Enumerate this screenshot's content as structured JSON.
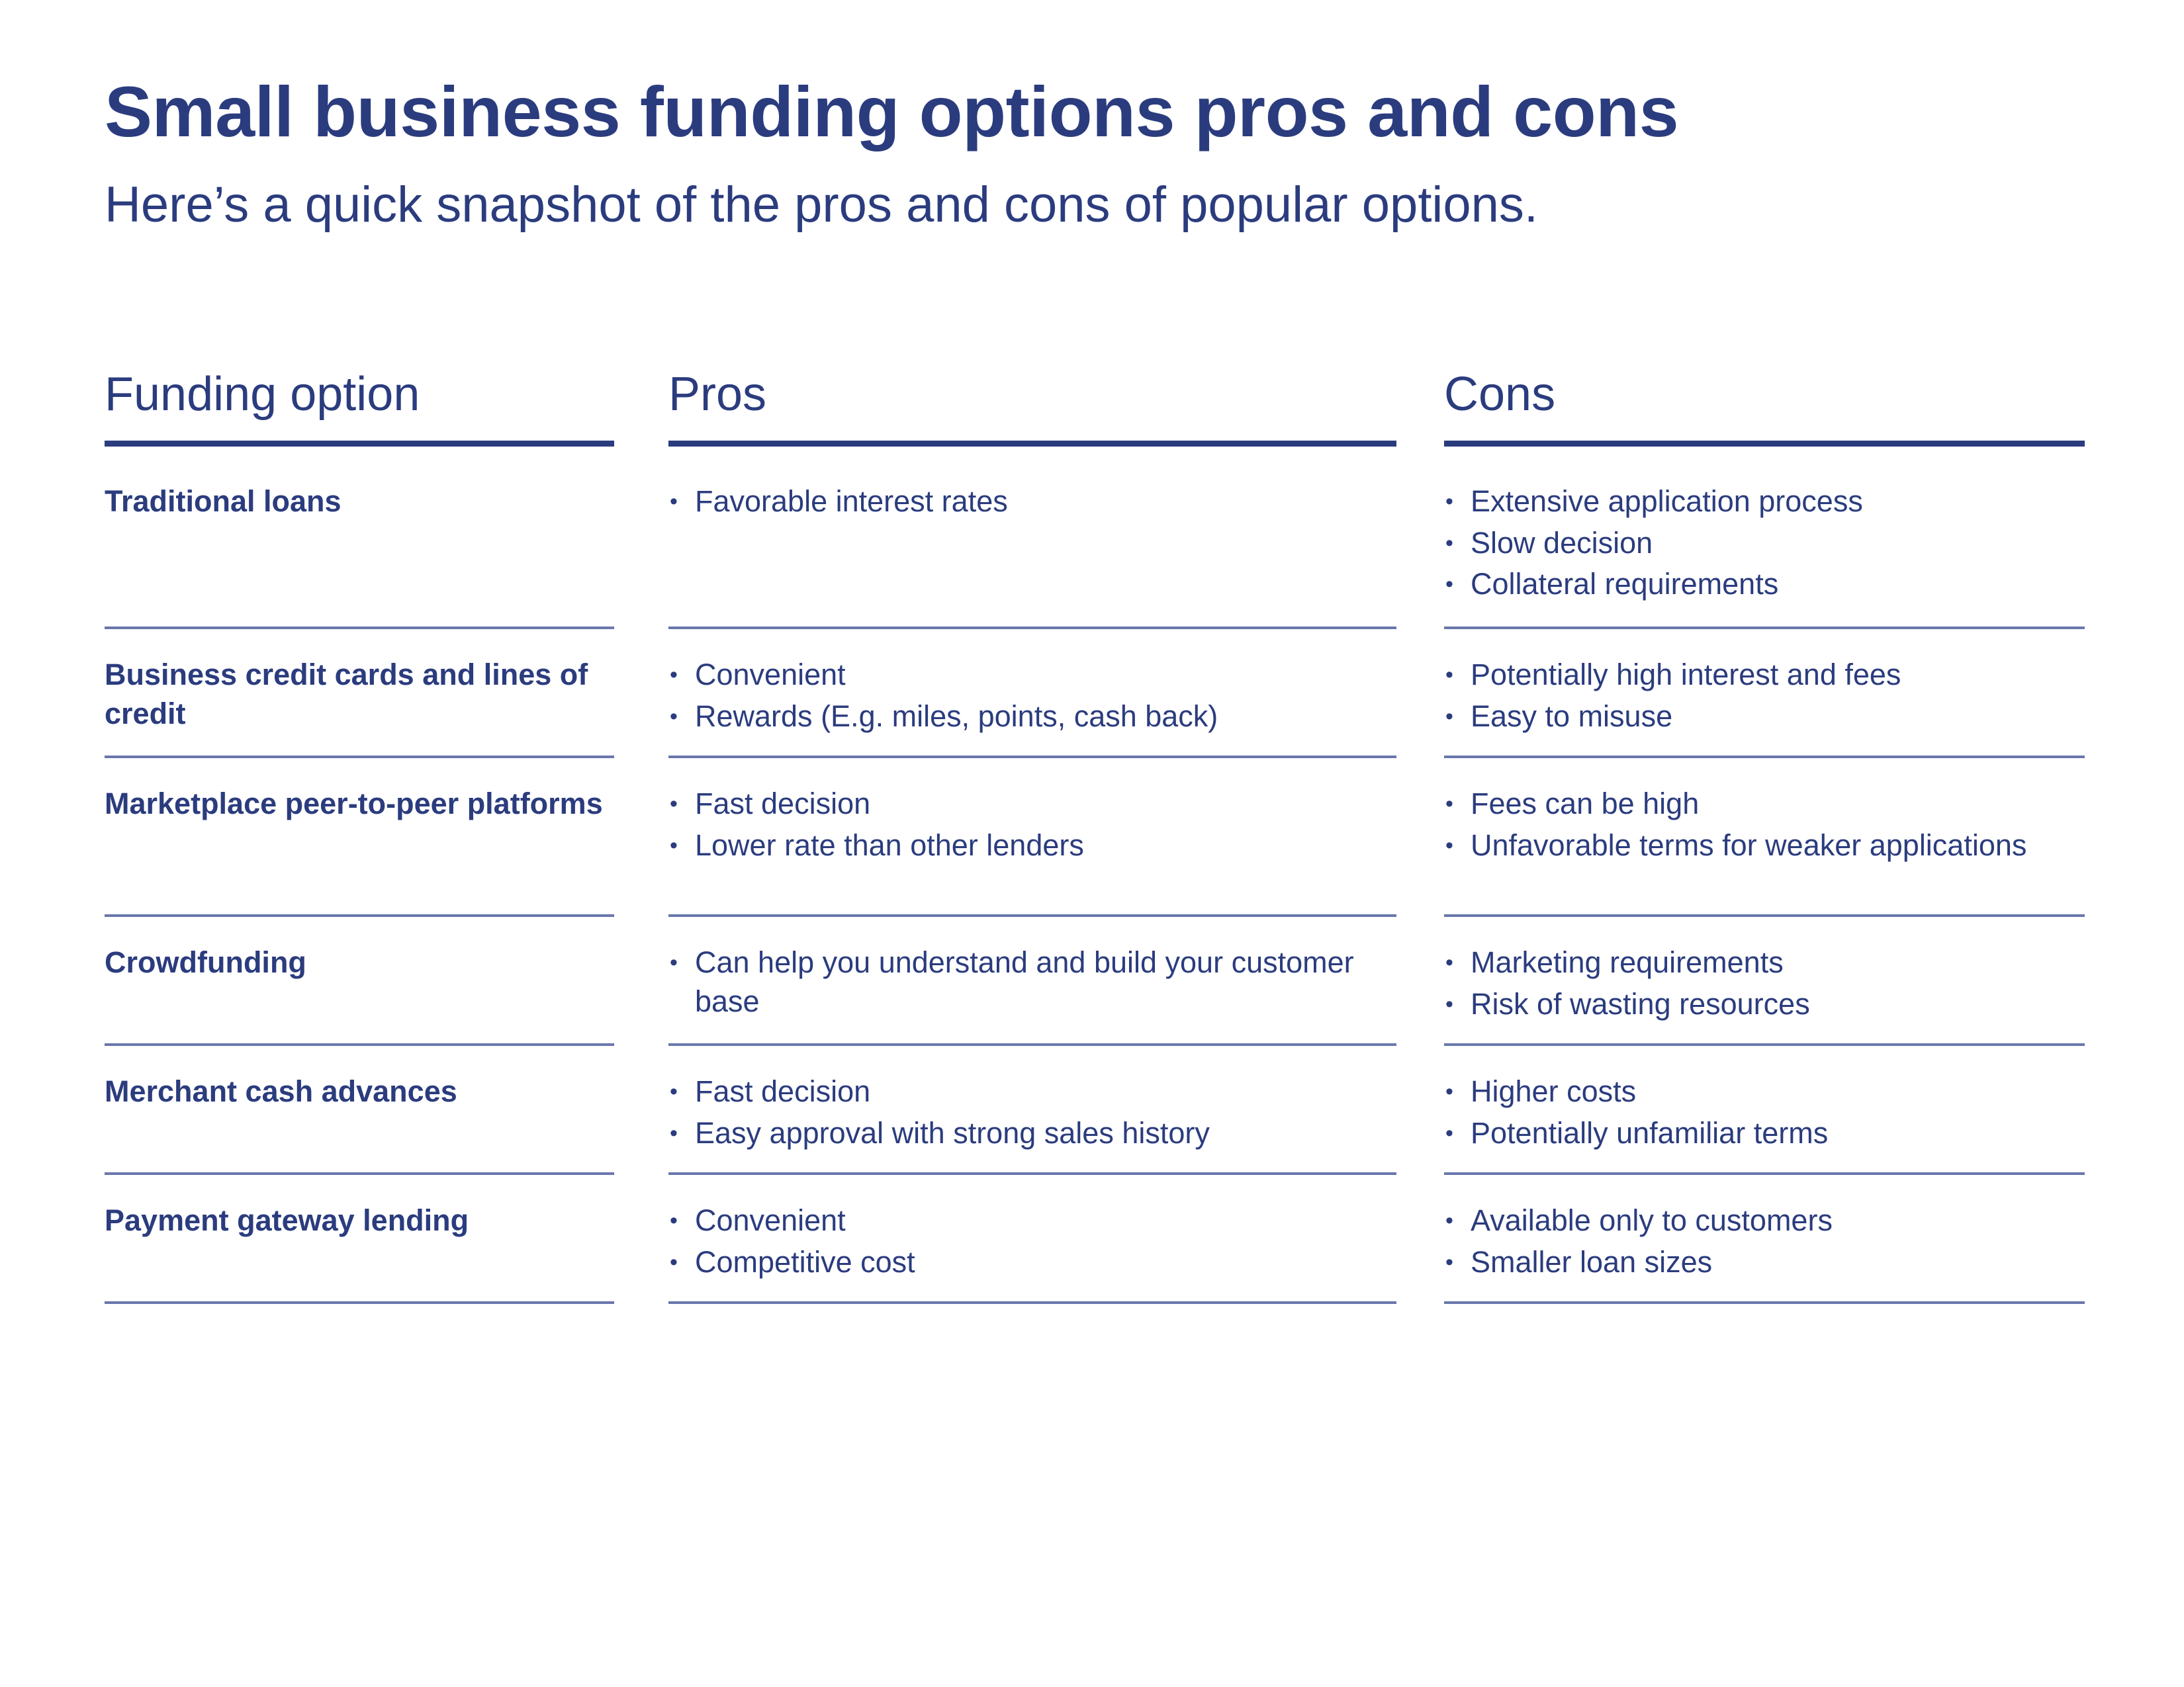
{
  "header": {
    "title": "Small business funding options pros and cons",
    "subtitle": "Here’s a quick snapshot of the pros and cons of popular options."
  },
  "colors": {
    "text": "#2b3c7e",
    "accent_rule": "#2b3c7e",
    "divider": "#6a77ab",
    "background": "#ffffff"
  },
  "table": {
    "columns": [
      {
        "label": "Funding option"
      },
      {
        "label": "Pros"
      },
      {
        "label": "Cons"
      }
    ],
    "rows": [
      {
        "option": "Traditional loans",
        "pros": [
          "Favorable interest rates"
        ],
        "cons": [
          "Extensive application process",
          "Slow decision",
          "Collateral requirements"
        ]
      },
      {
        "option": "Business credit cards and lines of credit",
        "pros": [
          "Convenient",
          "Rewards (E.g. miles, points, cash back)"
        ],
        "cons": [
          "Potentially high interest and fees",
          "Easy to misuse"
        ]
      },
      {
        "option": "Marketplace peer-to-peer platforms",
        "pros": [
          "Fast decision",
          "Lower rate than other lenders"
        ],
        "cons": [
          "Fees can be high",
          "Unfavorable terms for weaker applications"
        ]
      },
      {
        "option": "Crowdfunding",
        "pros": [
          "Can help you understand and build your customer base"
        ],
        "cons": [
          "Marketing requirements",
          "Risk of wasting resources"
        ]
      },
      {
        "option": "Merchant cash advances",
        "pros": [
          "Fast decision",
          "Easy approval with strong sales history"
        ],
        "cons": [
          "Higher costs",
          "Potentially unfamiliar terms"
        ]
      },
      {
        "option": "Payment gateway lending",
        "pros": [
          "Convenient",
          "Competitive cost"
        ],
        "cons": [
          "Available only to customers",
          "Smaller loan sizes"
        ]
      }
    ]
  }
}
